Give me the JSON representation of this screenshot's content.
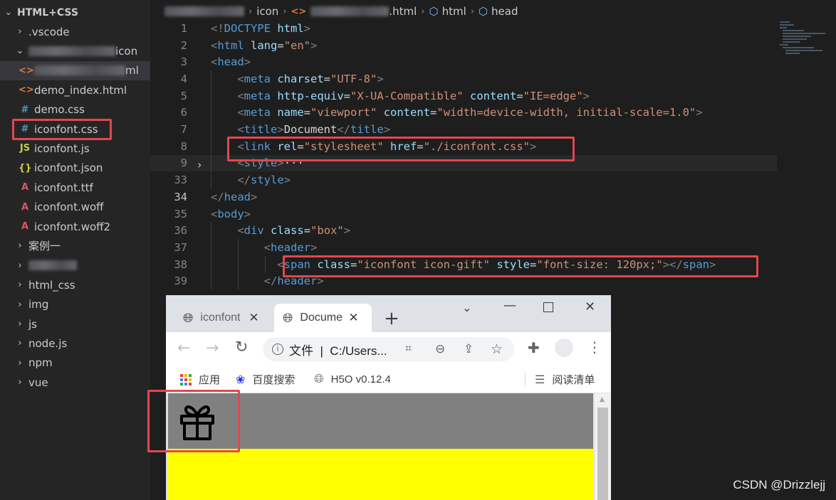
{
  "explorer": {
    "root": "HTML+CSS",
    "items": [
      {
        "label": ".vscode",
        "kind": "folder",
        "collapsed": true
      },
      {
        "label": "icon",
        "kind": "folder-open"
      },
      {
        "label": "ml",
        "kind": "html",
        "icon": "<>"
      },
      {
        "label": "demo_index.html",
        "kind": "html",
        "icon": "<>"
      },
      {
        "label": "demo.css",
        "kind": "css",
        "icon": "#"
      },
      {
        "label": "iconfont.css",
        "kind": "css",
        "icon": "#"
      },
      {
        "label": "iconfont.js",
        "kind": "js",
        "icon": "JS"
      },
      {
        "label": "iconfont.json",
        "kind": "json",
        "icon": "{}"
      },
      {
        "label": "iconfont.ttf",
        "kind": "font",
        "icon": "A"
      },
      {
        "label": "iconfont.woff",
        "kind": "font",
        "icon": "A"
      },
      {
        "label": "iconfont.woff2",
        "kind": "font",
        "icon": "A"
      },
      {
        "label": "案例一",
        "kind": "folder",
        "collapsed": true
      },
      {
        "label": "",
        "kind": "folder",
        "collapsed": true
      },
      {
        "label": "html_css",
        "kind": "folder",
        "collapsed": true
      },
      {
        "label": "img",
        "kind": "folder",
        "collapsed": true
      },
      {
        "label": "js",
        "kind": "folder",
        "collapsed": true
      },
      {
        "label": "node.js",
        "kind": "folder",
        "collapsed": true
      },
      {
        "label": "npm",
        "kind": "folder",
        "collapsed": true
      },
      {
        "label": "vue",
        "kind": "folder",
        "collapsed": true
      }
    ]
  },
  "breadcrumb": {
    "folder": "icon",
    "file_ext": ".html",
    "node1": "html",
    "node2": "head"
  },
  "code_lines": [
    {
      "num": "1",
      "tokens": [
        [
          "p",
          "<!"
        ],
        [
          "t",
          "DOCTYPE"
        ],
        [
          "x",
          " "
        ],
        [
          "a",
          "html"
        ],
        [
          "p",
          ">"
        ]
      ]
    },
    {
      "num": "2",
      "tokens": [
        [
          "p",
          "<"
        ],
        [
          "t",
          "html"
        ],
        [
          "x",
          " "
        ],
        [
          "a",
          "lang"
        ],
        [
          "x",
          "="
        ],
        [
          "s",
          "\"en\""
        ],
        [
          "p",
          ">"
        ]
      ]
    },
    {
      "num": "3",
      "tokens": [
        [
          "p",
          "<"
        ],
        [
          "t",
          "head"
        ],
        [
          "p",
          ">"
        ]
      ]
    },
    {
      "num": "4",
      "tokens": [
        [
          "x",
          "    "
        ],
        [
          "p",
          "<"
        ],
        [
          "t",
          "meta"
        ],
        [
          "x",
          " "
        ],
        [
          "a",
          "charset"
        ],
        [
          "x",
          "="
        ],
        [
          "s",
          "\"UTF-8\""
        ],
        [
          "p",
          ">"
        ]
      ]
    },
    {
      "num": "5",
      "tokens": [
        [
          "x",
          "    "
        ],
        [
          "p",
          "<"
        ],
        [
          "t",
          "meta"
        ],
        [
          "x",
          " "
        ],
        [
          "a",
          "http-equiv"
        ],
        [
          "x",
          "="
        ],
        [
          "s",
          "\"X-UA-Compatible\""
        ],
        [
          "x",
          " "
        ],
        [
          "a",
          "content"
        ],
        [
          "x",
          "="
        ],
        [
          "s",
          "\"IE=edge\""
        ],
        [
          "p",
          ">"
        ]
      ]
    },
    {
      "num": "6",
      "tokens": [
        [
          "x",
          "    "
        ],
        [
          "p",
          "<"
        ],
        [
          "t",
          "meta"
        ],
        [
          "x",
          " "
        ],
        [
          "a",
          "name"
        ],
        [
          "x",
          "="
        ],
        [
          "s",
          "\"viewport\""
        ],
        [
          "x",
          " "
        ],
        [
          "a",
          "content"
        ],
        [
          "x",
          "="
        ],
        [
          "s",
          "\"width=device-width, initial-scale=1.0\""
        ],
        [
          "p",
          ">"
        ]
      ]
    },
    {
      "num": "7",
      "tokens": [
        [
          "x",
          "    "
        ],
        [
          "p",
          "<"
        ],
        [
          "t",
          "title"
        ],
        [
          "p",
          ">"
        ],
        [
          "x",
          "Document"
        ],
        [
          "p",
          "</"
        ],
        [
          "t",
          "title"
        ],
        [
          "p",
          ">"
        ]
      ]
    },
    {
      "num": "8",
      "tokens": [
        [
          "x",
          "    "
        ],
        [
          "p",
          "<"
        ],
        [
          "t",
          "link"
        ],
        [
          "x",
          " "
        ],
        [
          "a",
          "rel"
        ],
        [
          "x",
          "="
        ],
        [
          "s",
          "\"stylesheet\""
        ],
        [
          "x",
          " "
        ],
        [
          "a",
          "href"
        ],
        [
          "x",
          "="
        ],
        [
          "s",
          "\"./iconfont.css\""
        ],
        [
          "p",
          ">"
        ]
      ]
    },
    {
      "num": "9",
      "tokens": [
        [
          "x",
          "    "
        ],
        [
          "p",
          "<"
        ],
        [
          "t",
          "style"
        ],
        [
          "p",
          ">"
        ],
        [
          "x",
          "···"
        ]
      ]
    },
    {
      "num": "33",
      "tokens": [
        [
          "x",
          "    "
        ],
        [
          "p",
          "</"
        ],
        [
          "t",
          "style"
        ],
        [
          "p",
          ">"
        ]
      ]
    },
    {
      "num": "34",
      "tokens": [
        [
          "p",
          "</"
        ],
        [
          "t",
          "head"
        ],
        [
          "p",
          ">"
        ]
      ]
    },
    {
      "num": "35",
      "tokens": [
        [
          "p",
          "<"
        ],
        [
          "t",
          "body"
        ],
        [
          "p",
          ">"
        ]
      ]
    },
    {
      "num": "36",
      "tokens": [
        [
          "x",
          "    "
        ],
        [
          "p",
          "<"
        ],
        [
          "t",
          "div"
        ],
        [
          "x",
          " "
        ],
        [
          "a",
          "class"
        ],
        [
          "x",
          "="
        ],
        [
          "s",
          "\"box\""
        ],
        [
          "p",
          ">"
        ]
      ]
    },
    {
      "num": "37",
      "tokens": [
        [
          "x",
          "        "
        ],
        [
          "p",
          "<"
        ],
        [
          "t",
          "header"
        ],
        [
          "p",
          ">"
        ]
      ]
    },
    {
      "num": "38",
      "tokens": [
        [
          "x",
          "          "
        ],
        [
          "p",
          "<"
        ],
        [
          "t",
          "span"
        ],
        [
          "x",
          " "
        ],
        [
          "a",
          "class"
        ],
        [
          "x",
          "="
        ],
        [
          "s",
          "\"iconfont icon-gift\""
        ],
        [
          "x",
          " "
        ],
        [
          "a",
          "style"
        ],
        [
          "x",
          "="
        ],
        [
          "s",
          "\"font-size: 120px;\""
        ],
        [
          "p",
          "></"
        ],
        [
          "t",
          "span"
        ],
        [
          "p",
          ">"
        ]
      ]
    },
    {
      "num": "39",
      "tokens": [
        [
          "x",
          "        "
        ],
        [
          "p",
          "</"
        ],
        [
          "t",
          "header"
        ],
        [
          "p",
          ">"
        ]
      ]
    }
  ],
  "browser": {
    "tabs": [
      {
        "title": "iconfont"
      },
      {
        "title": "Docume"
      }
    ],
    "new_tab": "+",
    "address": "文件  |  C:/Users...",
    "bookmarks": [
      {
        "label": "应用"
      },
      {
        "label": "百度搜索"
      },
      {
        "label": "H5O v0.12.4"
      }
    ],
    "reading_list": "阅读清单"
  },
  "colors": {
    "highlight": "#e2474f",
    "page_header_bg": "#808080",
    "page_box_bg": "#ffff00"
  },
  "watermark": "CSDN @Drizzlejj"
}
